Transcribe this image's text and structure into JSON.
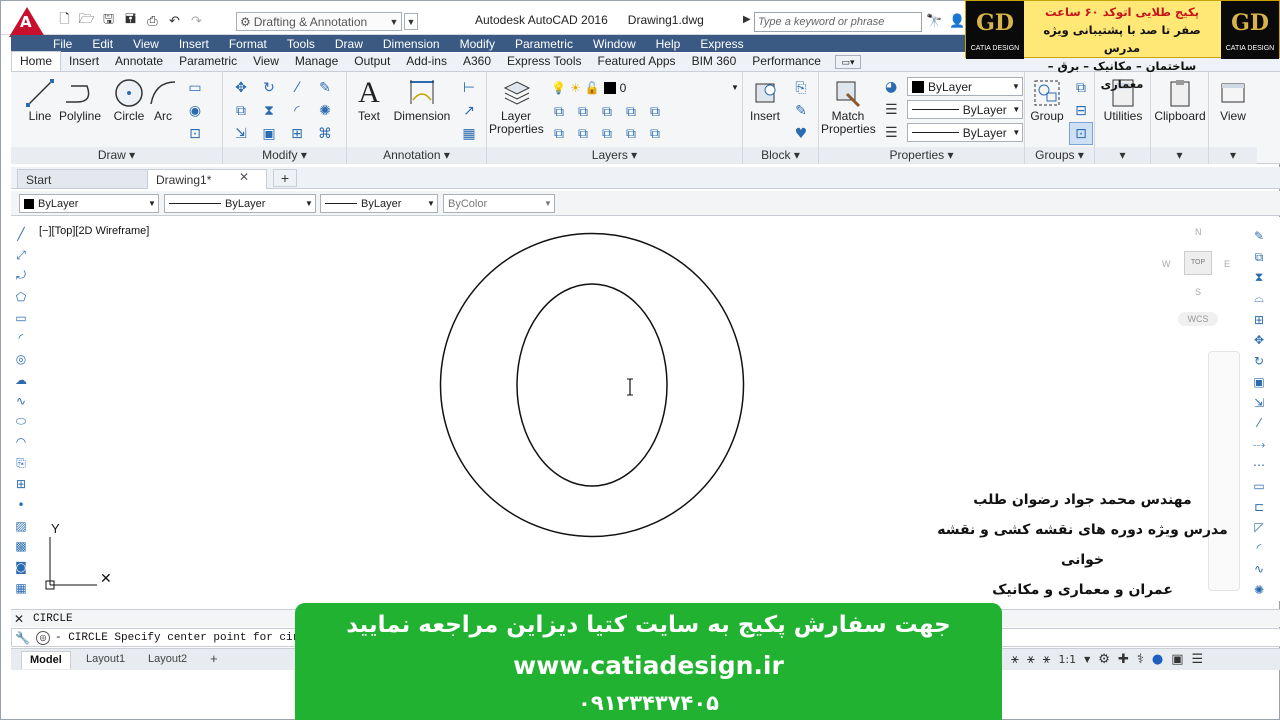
{
  "title": {
    "app_name": "Autodesk AutoCAD 2016",
    "file_name": "Drawing1.dwg",
    "workspace": "Drafting & Annotation",
    "search_placeholder": "Type a keyword or phrase"
  },
  "menubar": [
    "File",
    "Edit",
    "View",
    "Insert",
    "Format",
    "Tools",
    "Draw",
    "Dimension",
    "Modify",
    "Parametric",
    "Window",
    "Help",
    "Express"
  ],
  "ribbon_tabs": [
    "Home",
    "Insert",
    "Annotate",
    "Parametric",
    "View",
    "Manage",
    "Output",
    "Add-ins",
    "A360",
    "Express Tools",
    "Featured Apps",
    "BIM 360",
    "Performance"
  ],
  "ribbon": {
    "draw": {
      "title": "Draw",
      "line": "Line",
      "polyline": "Polyline",
      "circle": "Circle",
      "arc": "Arc"
    },
    "modify": {
      "title": "Modify"
    },
    "annotation": {
      "title": "Annotation",
      "text": "Text",
      "dimension": "Dimension"
    },
    "layers": {
      "title": "Layers",
      "layer_properties": "Layer\nProperties",
      "current_layer": "0"
    },
    "block": {
      "title": "Block",
      "insert": "Insert"
    },
    "properties": {
      "title": "Properties",
      "match_properties": "Match\nProperties",
      "color": "ByLayer",
      "linetype": "ByLayer",
      "lineweight": "ByLayer"
    },
    "groups": {
      "title": "Groups",
      "group": "Group"
    },
    "utilities": "Utilities",
    "clipboard": "Clipboard",
    "view": "View"
  },
  "doc_tabs": {
    "start": "Start",
    "drawing": "Drawing1*"
  },
  "props_toolbar": {
    "color": "ByLayer",
    "linetype": "ByLayer",
    "lineweight": "ByLayer",
    "plotstyle": "ByColor"
  },
  "viewport": {
    "label": "[−][Top][2D Wireframe]",
    "ucs_y": "Y"
  },
  "viewcube": {
    "north": "N",
    "west": "W",
    "east": "E",
    "south": "S",
    "face": "TOP",
    "wcs": "WCS"
  },
  "command": {
    "history": "CIRCLE",
    "input": "- CIRCLE Specify center point for cir"
  },
  "layout_tabs": [
    "Model",
    "Layout1",
    "Layout2"
  ],
  "status": {
    "scale": "1:1"
  },
  "overlay_top": {
    "line1": "پکیج طلایی اتوکد ۶۰ ساعت",
    "line2": "صفر تا صد با پشتیبانی ویژه مدرس",
    "line3": "ساختمان – مکانیک – برق – معماری",
    "logo_text": "CATIA DESIGN"
  },
  "overlay_credit": {
    "line1": "مهندس محمد جواد رضوان طلب",
    "line2": "مدرس ویژه دوره های نقشه کشی و نقشه خوانی",
    "line3": "عمران و معماری و مکانیک"
  },
  "overlay_bottom": {
    "line1": "جهت سفارش پکیج به سایت کتیا دیزاین مراجعه نمایید",
    "line2": "www.catiadesign.ir",
    "line3": "۰۹۱۲۳۴۳۷۴۰۵"
  },
  "colors": {
    "menubar": "#3a5a84",
    "promo_green": "#21b231",
    "promo_yellow": "#ffe875",
    "brand_red": "#c8102e"
  }
}
